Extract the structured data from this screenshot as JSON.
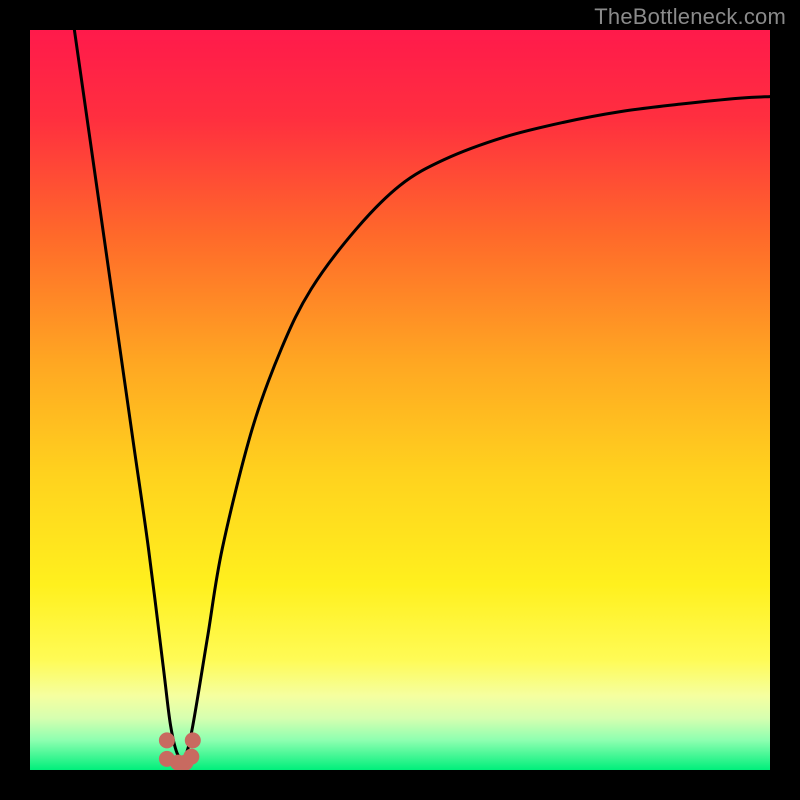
{
  "watermark": "TheBottleneck.com",
  "chart_data": {
    "type": "line",
    "title": "",
    "xlabel": "",
    "ylabel": "",
    "xlim": [
      0,
      100
    ],
    "ylim": [
      0,
      100
    ],
    "grid": false,
    "legend": false,
    "background_gradient_stops": [
      {
        "pct": 0,
        "color": "#ff1a4b"
      },
      {
        "pct": 12,
        "color": "#ff2f3f"
      },
      {
        "pct": 28,
        "color": "#ff6a2a"
      },
      {
        "pct": 45,
        "color": "#ffa722"
      },
      {
        "pct": 60,
        "color": "#ffd21e"
      },
      {
        "pct": 75,
        "color": "#fff01e"
      },
      {
        "pct": 85,
        "color": "#fffb55"
      },
      {
        "pct": 90,
        "color": "#f5ffa0"
      },
      {
        "pct": 93,
        "color": "#d6ffb0"
      },
      {
        "pct": 96,
        "color": "#8dffb0"
      },
      {
        "pct": 100,
        "color": "#00ef7b"
      }
    ],
    "series": [
      {
        "name": "bottleneck-curve",
        "color": "#000000",
        "x": [
          6,
          8,
          10,
          12,
          14,
          16,
          18,
          19,
          20,
          21,
          22,
          24,
          26,
          30,
          34,
          38,
          44,
          50,
          56,
          64,
          72,
          80,
          88,
          96,
          100
        ],
        "values": [
          100,
          86,
          72,
          58,
          44,
          30,
          14,
          6,
          2,
          2,
          6,
          18,
          30,
          46,
          57,
          65,
          73,
          79,
          82.5,
          85.5,
          87.5,
          89,
          90,
          90.8,
          91
        ]
      }
    ],
    "marker_cluster": {
      "color": "#c86a60",
      "radius_px": 8,
      "points_xy": [
        [
          18.5,
          4.0
        ],
        [
          18.5,
          1.5
        ],
        [
          20.0,
          1.0
        ],
        [
          21.0,
          1.0
        ],
        [
          21.8,
          1.8
        ],
        [
          22.0,
          4.0
        ]
      ]
    }
  }
}
